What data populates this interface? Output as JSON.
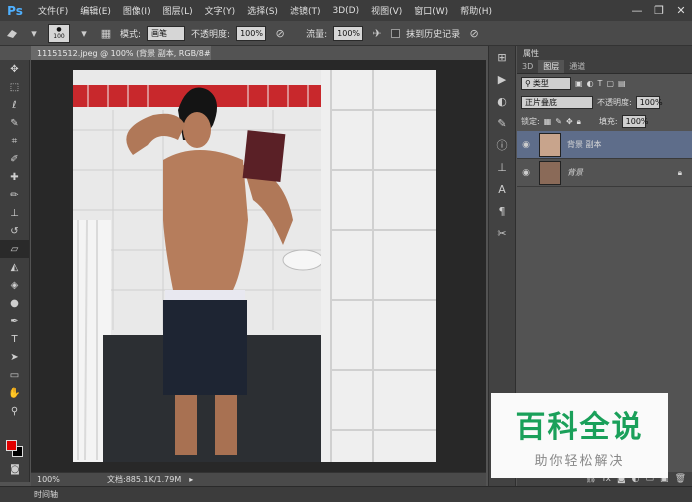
{
  "app": {
    "logo": "Ps"
  },
  "menu": [
    "文件(F)",
    "编辑(E)",
    "图像(I)",
    "图层(L)",
    "文字(Y)",
    "选择(S)",
    "滤镜(T)",
    "3D(D)",
    "视图(V)",
    "窗口(W)",
    "帮助(H)"
  ],
  "window_controls": {
    "minimize": "—",
    "restore": "❐",
    "close": "✕"
  },
  "options": {
    "brush_size": "100",
    "mode_label": "模式:",
    "mode_value": "画笔",
    "opacity_label": "不透明度:",
    "opacity_value": "100%",
    "flow_label": "流量:",
    "flow_value": "100%",
    "history_label": "抹到历史记录"
  },
  "document": {
    "tab_title": "11151512.jpeg @ 100% (背景 副本, RGB/8#) *",
    "tab_close": "×",
    "zoom": "100%",
    "doc_info": "文档:885.1K/1.79M"
  },
  "timeline": {
    "label": "时间轴"
  },
  "panel": {
    "header": "属性",
    "tabs": [
      "3D",
      "图层",
      "通道"
    ],
    "active_tab": 1,
    "filter_kind": "类型",
    "blend_mode": "正片叠底",
    "opacity_label": "不透明度:",
    "opacity_value": "100%",
    "lock_label": "锁定:",
    "fill_label": "填充:",
    "fill_value": "100%",
    "layers": [
      {
        "name": "背景 副本",
        "selected": true
      },
      {
        "name": "背景",
        "selected": false
      }
    ]
  },
  "watermark": {
    "title": "百科全说",
    "subtitle": "助你轻松解决"
  },
  "colors": {
    "foreground": "#e00000",
    "background": "#000000",
    "accent_green": "#1aa05a",
    "selected_layer": "#5e6d8a"
  }
}
